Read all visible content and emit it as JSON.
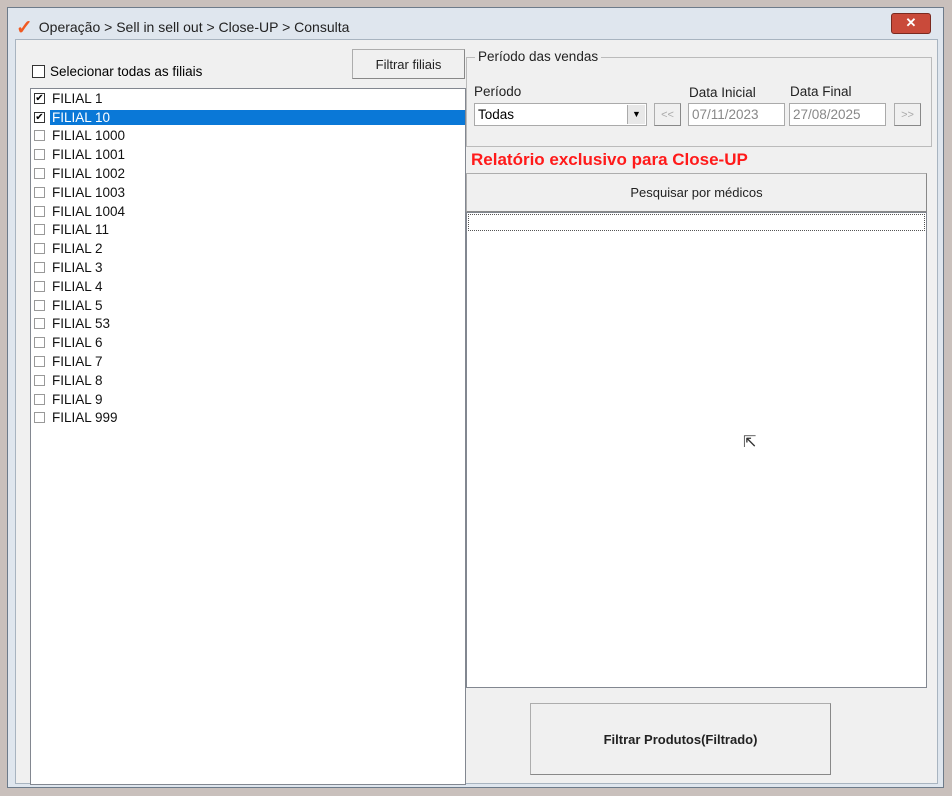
{
  "window": {
    "title": "Operação > Sell in sell out > Close-UP > Consulta",
    "close_label": "✕"
  },
  "left": {
    "select_all_label": "Selecionar todas as filiais",
    "filter_button": "Filtrar filiais",
    "branches": [
      {
        "label": "FILIAL 1",
        "checked": true
      },
      {
        "label": "FILIAL 10",
        "checked": true,
        "selected": true
      },
      {
        "label": "FILIAL 1000",
        "checked": false
      },
      {
        "label": "FILIAL 1001",
        "checked": false
      },
      {
        "label": "FILIAL 1002",
        "checked": false
      },
      {
        "label": "FILIAL 1003",
        "checked": false
      },
      {
        "label": "FILIAL 1004",
        "checked": false
      },
      {
        "label": "FILIAL 11",
        "checked": false
      },
      {
        "label": "FILIAL 2",
        "checked": false
      },
      {
        "label": "FILIAL 3",
        "checked": false
      },
      {
        "label": "FILIAL 4",
        "checked": false
      },
      {
        "label": "FILIAL 5",
        "checked": false
      },
      {
        "label": "FILIAL 53",
        "checked": false
      },
      {
        "label": "FILIAL 6",
        "checked": false
      },
      {
        "label": "FILIAL 7",
        "checked": false
      },
      {
        "label": "FILIAL 8",
        "checked": false
      },
      {
        "label": "FILIAL 9",
        "checked": false
      },
      {
        "label": "FILIAL 999",
        "checked": false
      }
    ]
  },
  "period": {
    "group_label": "Período das vendas",
    "period_label": "Período",
    "period_value": "Todas",
    "start_label": "Data Inicial",
    "start_value": "07/11/2023",
    "end_label": "Data Final",
    "end_value": "27/08/2025",
    "prev_label": "<<",
    "next_label": ">>"
  },
  "notice": "Relatório exclusivo para Close-UP",
  "notice_color": "#ff1a1a",
  "search_doctors_button": "Pesquisar por médicos",
  "filter_products_button": "Filtrar Produtos(Filtrado)"
}
